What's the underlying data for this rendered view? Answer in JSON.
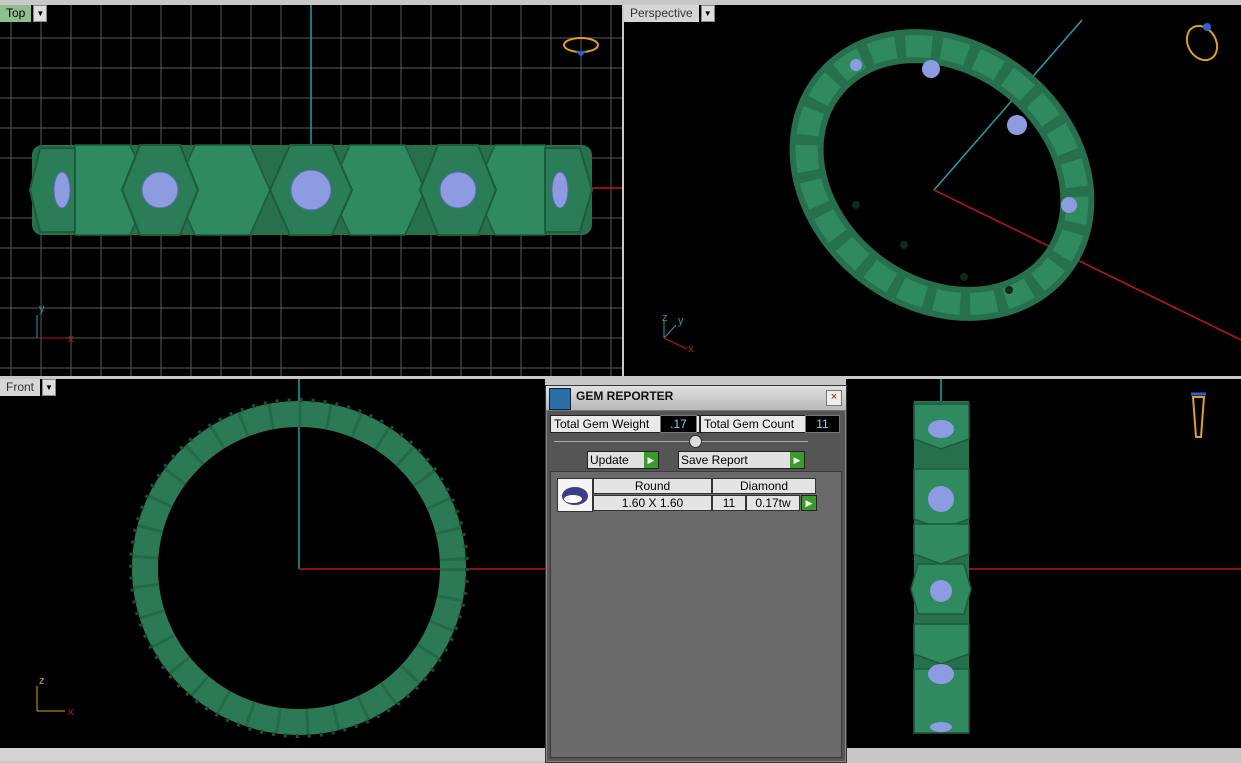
{
  "viewports": {
    "top": {
      "label": "Top"
    },
    "perspective": {
      "label": "Perspective"
    },
    "front": {
      "label": "Front"
    },
    "right": {
      "label": ""
    }
  },
  "axes": {
    "x": "x",
    "y": "y",
    "z": "z"
  },
  "gem_reporter": {
    "title": "GEM REPORTER",
    "close": "×",
    "total_weight_label": "Total Gem Weight",
    "total_weight_value": ".17",
    "total_count_label": "Total Gem Count",
    "total_count_value": "11",
    "update_label": "Update",
    "save_report_label": "Save Report",
    "gem_rows": [
      {
        "shape": "Round",
        "material": "Diamond",
        "size": "1.60 X 1.60",
        "count": "11",
        "weight": "0.17tw"
      }
    ]
  },
  "colors": {
    "metal": "#2b7a55",
    "gem": "#8d9be0",
    "grid": "#5a5a5a",
    "axis_x": "#c01515",
    "axis_y": "#1a9fb0",
    "active_tab": "#8fbf8f"
  }
}
